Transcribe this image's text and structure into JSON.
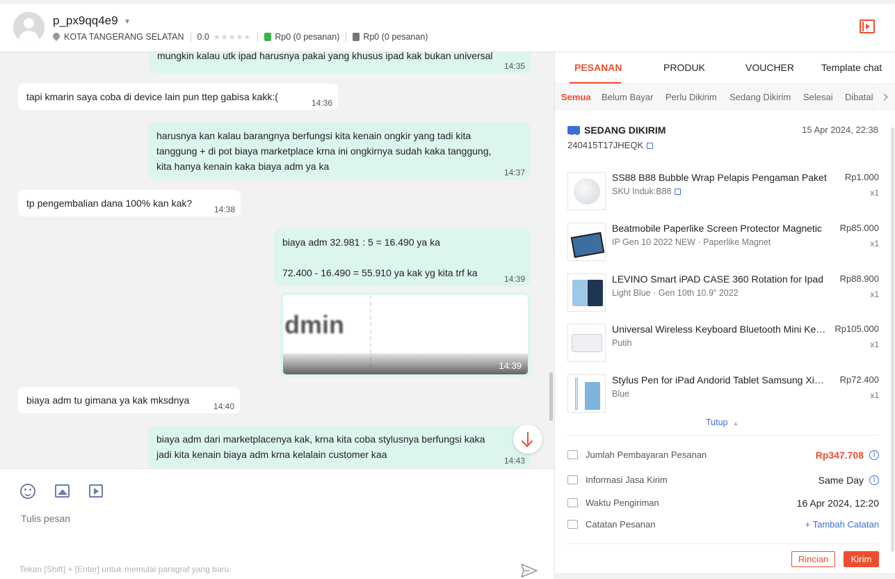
{
  "header": {
    "username": "p_px9qq4e9",
    "location": "KOTA TANGERANG SELATAN",
    "rating": "0.0",
    "stat1": "Rp0 (0 pesanan)",
    "stat2": "Rp0 (0 pesanan)"
  },
  "chat": {
    "messages": [
      {
        "dir": "out",
        "text": "mungkin kalau utk ipad harusnya pakai yang khusus ipad kak bukan universal",
        "time": "14:35"
      },
      {
        "dir": "in",
        "text": "tapi kmarin saya coba di device lain pun ttep gabisa kakk:(",
        "time": "14:36"
      },
      {
        "dir": "out",
        "text": "harusnya kan kalau barangnya berfungsi kita kenain ongkir yang tadi kita\ntanggung + di pot biaya marketplace krna ini ongkirnya sudah kaka tanggung,\nkita hanya kenain kaka biaya adm ya ka",
        "time": "14:37"
      },
      {
        "dir": "in",
        "text": "tp pengembalian dana 100% kan kak?",
        "time": "14:38"
      },
      {
        "dir": "out",
        "text": "biaya adm 32.981 : 5 = 16.490 ya ka\n\n72.400 - 16.490 = 55.910 ya kak yg kita trf ka",
        "time": "14:39"
      },
      {
        "dir": "out",
        "type": "image",
        "image_text": "dmin",
        "time": "14:39"
      },
      {
        "dir": "in",
        "text": "biaya adm tu gimana ya kak mksdnya",
        "time": "14:40"
      },
      {
        "dir": "out",
        "text": "biaya adm dari marketplacenya kak, krna kita coba stylusnya berfungsi kaka\njadi kita kenain biaya adm krna kelalain customer kaa",
        "time": "14:43"
      }
    ]
  },
  "composer": {
    "placeholder": "Tulis pesan",
    "hint": "Tekan [Shift] + [Enter] untuk memulai paragraf yang baru."
  },
  "panel": {
    "tabs": [
      "PESANAN",
      "PRODUK",
      "VOUCHER",
      "Template chat"
    ],
    "subtabs": [
      "Semua",
      "Belum Bayar",
      "Perlu Dikirim",
      "Sedang Dikirim",
      "Selesai",
      "Dibatalkan"
    ],
    "order": {
      "status": "SEDANG DIKIRIM",
      "date": "15 Apr 2024, 22:38",
      "id": "240415T17JHEQK",
      "products": [
        {
          "name": "SS88 B88 Bubble Wrap Pelapis Pengaman Paket",
          "variant": "SKU Induk:B88",
          "price": "Rp1.000",
          "qty": "x1",
          "thumb": "bubble-wrap"
        },
        {
          "name": "Beatmobile Paperlike Screen Protector Magnetic",
          "variant": "IP Gen 10 2022 NEW · Paperlike Magnet",
          "price": "Rp85.000",
          "qty": "x1",
          "thumb": "screen-protector"
        },
        {
          "name": "LEVINO Smart iPAD CASE 360 Rotation for Ipad",
          "variant": "Light Blue · Gen 10th 10.9\" 2022",
          "price": "Rp88.900",
          "qty": "x1",
          "thumb": "ipad-case"
        },
        {
          "name": "Universal Wireless Keyboard Bluetooth Mini Keyboard",
          "variant": "Putih",
          "price": "Rp105.000",
          "qty": "x1",
          "thumb": "keyboard"
        },
        {
          "name": "Stylus Pen for iPad Andorid Tablet Samsung Xiaomi",
          "variant": "Blue",
          "price": "Rp72.400",
          "qty": "x1",
          "thumb": "stylus"
        }
      ],
      "collapse_label": "Tutup",
      "payment_label": "Jumlah Pembayaran Pesanan",
      "payment_value": "Rp347.708",
      "shipping_label": "Informasi Jasa Kirim",
      "shipping_value": "Same Day",
      "ship_time_label": "Waktu Pengiriman",
      "ship_time_value": "16 Apr 2024, 12:20",
      "note_label": "Catatan Pesanan",
      "note_action": "+ Tambah Catatan",
      "details_button": "Rincian",
      "send_button": "Kirim"
    }
  },
  "colors": {
    "accent": "#ee4d2d",
    "bubble_out": "#dcf6ec",
    "bubble_in": "#ffffff",
    "link": "#3d6ed9"
  }
}
